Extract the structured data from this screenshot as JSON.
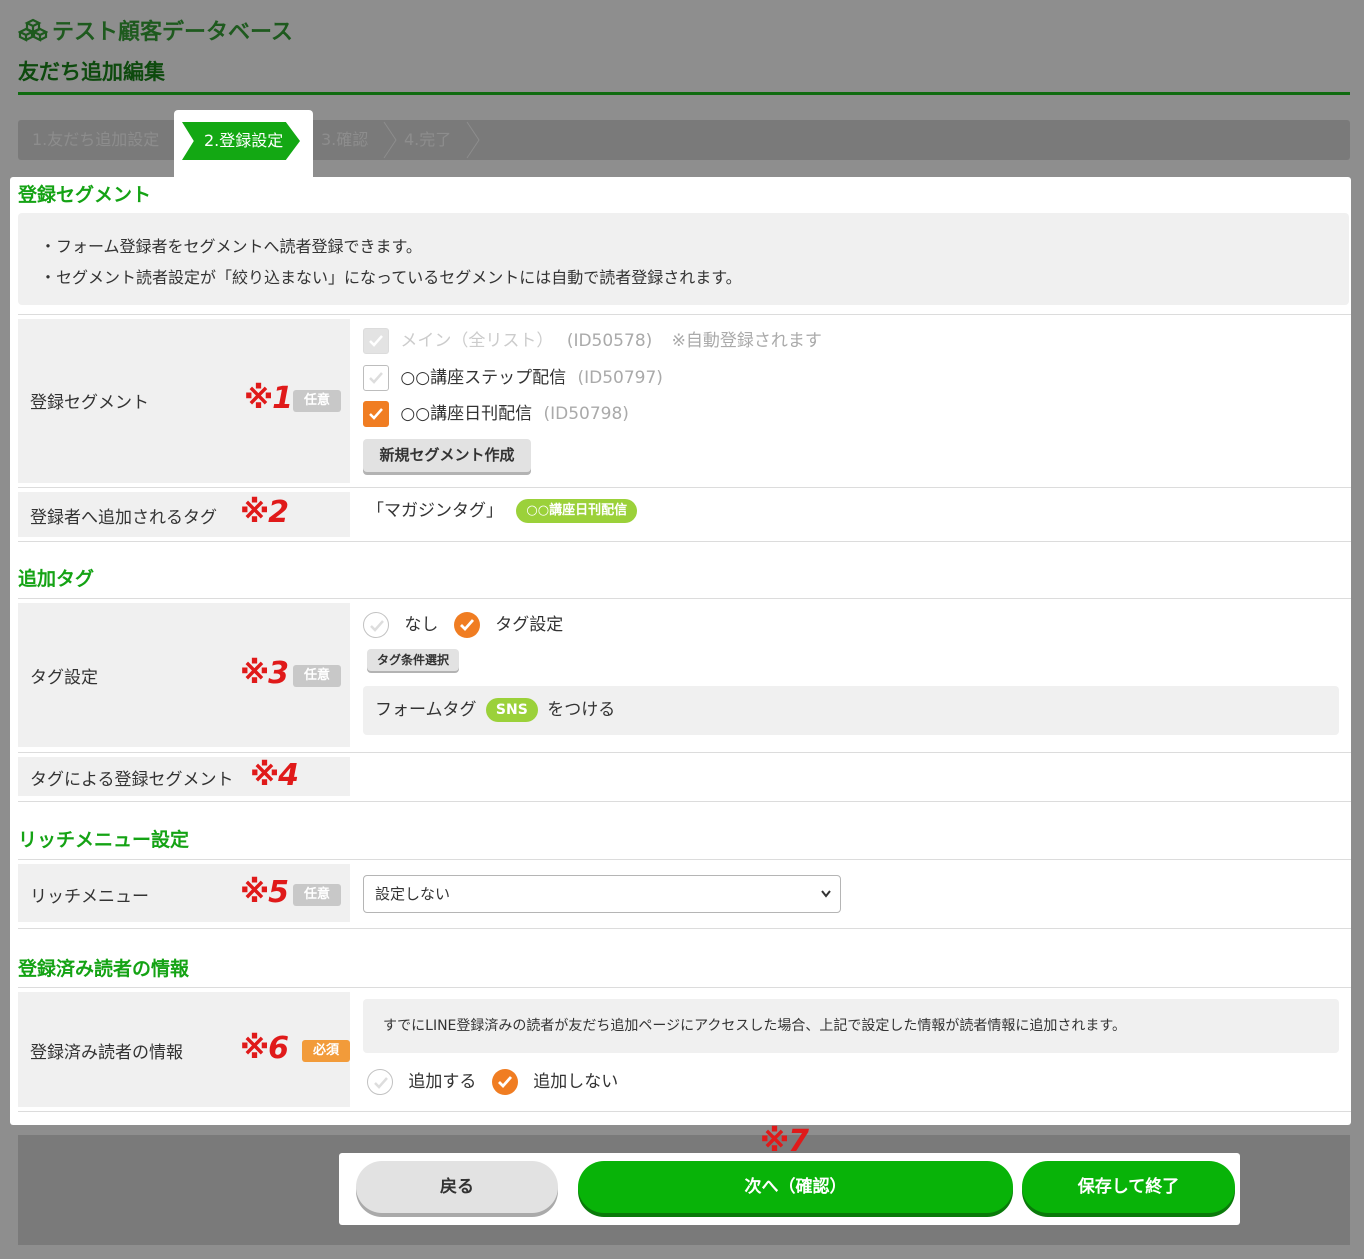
{
  "app": {
    "title": "テスト顧客データベース",
    "logo_icon": "cubes-icon"
  },
  "page": {
    "title": "友だち追加編集"
  },
  "steps": [
    {
      "label": "1.友だち追加設定"
    },
    {
      "label": "2.登録設定"
    },
    {
      "label": "3.確認"
    },
    {
      "label": "4.完了"
    }
  ],
  "segment_section": {
    "title": "登録セグメント",
    "info": [
      "・フォーム登録者をセグメントへ読者登録できます。",
      "・セグメント読者設定が「絞り込まない」になっているセグメントには自動で読者登録されます。"
    ],
    "label": "登録セグメント",
    "mark": "※1",
    "badge": "任意",
    "options": [
      {
        "name": "メイン（全リスト）",
        "id": "(ID50578)",
        "note": "※自動登録されます",
        "state": "disabled"
      },
      {
        "name": "○○講座ステップ配信",
        "id": "(ID50797)",
        "state": "unchecked"
      },
      {
        "name": "○○講座日刊配信",
        "id": "(ID50798)",
        "state": "checked"
      }
    ],
    "create_button": "新規セグメント作成",
    "tag_label": "登録者へ追加されるタグ",
    "tag_mark": "※2",
    "tag_prefix": "「マガジンタグ」",
    "tag_pill": "○○講座日刊配信"
  },
  "tag_section": {
    "title": "追加タグ",
    "label": "タグ設定",
    "mark": "※3",
    "badge": "任意",
    "radio_none": "なし",
    "radio_set": "タグ設定",
    "selected": "タグ設定",
    "cond_button": "タグ条件選択",
    "form_tag_prefix": "フォームタグ",
    "form_tag_pill": "SNS",
    "form_tag_suffix": "をつける",
    "seg_label": "タグによる登録セグメント",
    "seg_mark": "※4"
  },
  "rich_section": {
    "title": "リッチメニュー設定",
    "label": "リッチメニュー",
    "mark": "※5",
    "badge": "任意",
    "select_value": "設定しない"
  },
  "registered_section": {
    "title": "登録済み読者の情報",
    "label": "登録済み読者の情報",
    "mark": "※6",
    "badge": "必須",
    "info": "すでにLINE登録済みの読者が友だち追加ページにアクセスした場合、上記で設定した情報が読者情報に追加されます。",
    "radio_add": "追加する",
    "radio_noadd": "追加しない",
    "selected": "追加しない"
  },
  "footer": {
    "mark": "※7",
    "back": "戻る",
    "next": "次へ（確認）",
    "save": "保存して終了"
  },
  "colors": {
    "accent_green": "#13a813",
    "orange": "#f07d22",
    "annotation_red": "#e01a1a"
  }
}
